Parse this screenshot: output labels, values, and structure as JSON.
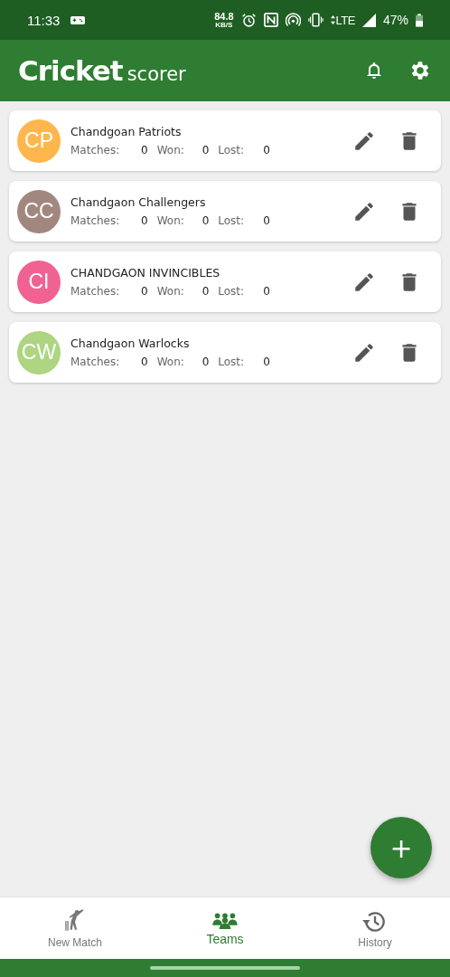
{
  "status_bar": {
    "time": "11:33",
    "speed": "84.8",
    "speed_unit": "KB/S",
    "network": "LTE",
    "battery": "47%"
  },
  "app_bar": {
    "title": "Cricket",
    "subtitle": "scorer"
  },
  "teams": [
    {
      "initials": "CP",
      "color": "#ffb74d",
      "name": "Chandgoan Patriots",
      "matches_label": "Matches:",
      "matches": "0",
      "won_label": "Won:",
      "won": "0",
      "lost_label": "Lost:",
      "lost": "0"
    },
    {
      "initials": "CC",
      "color": "#a1887f",
      "name": "Chandgaon Challengers",
      "matches_label": "Matches:",
      "matches": "0",
      "won_label": "Won:",
      "won": "0",
      "lost_label": "Lost:",
      "lost": "0"
    },
    {
      "initials": "CI",
      "color": "#f06292",
      "name": "CHANDGAON INVINCIBLES",
      "matches_label": "Matches:",
      "matches": "0",
      "won_label": "Won:",
      "won": "0",
      "lost_label": "Lost:",
      "lost": "0"
    },
    {
      "initials": "CW",
      "color": "#aed581",
      "name": "Chandgaon Warlocks",
      "matches_label": "Matches:",
      "matches": "0",
      "won_label": "Won:",
      "won": "0",
      "lost_label": "Lost:",
      "lost": "0"
    }
  ],
  "fab": {
    "label": "+"
  },
  "bottom_nav": [
    {
      "kind": "match",
      "label": "New Match",
      "selected": false
    },
    {
      "kind": "teams",
      "label": "Teams",
      "selected": true
    },
    {
      "kind": "history",
      "label": "History",
      "selected": false
    }
  ]
}
